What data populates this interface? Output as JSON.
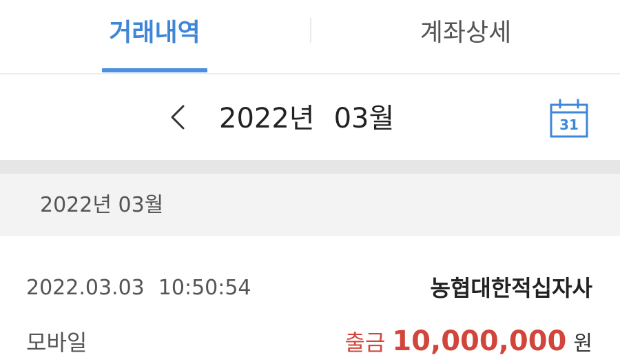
{
  "tabs": {
    "active_label": "거래내역",
    "inactive_label": "계좌상세",
    "accent_color": "#3f86d8"
  },
  "month_nav": {
    "year": "2022년",
    "month": "03월",
    "prev_icon": "chevron-left-icon",
    "calendar_icon": "calendar-icon",
    "calendar_day": "31"
  },
  "section": {
    "header": "2022년 03월"
  },
  "transactions": [
    {
      "date": "2022.03.03",
      "time": "10:50:54",
      "payee": "농협대한적십자사",
      "channel": "모바일",
      "type": "출금",
      "amount": "10,000,000",
      "currency": "원",
      "type_color": "#d2453a"
    }
  ]
}
